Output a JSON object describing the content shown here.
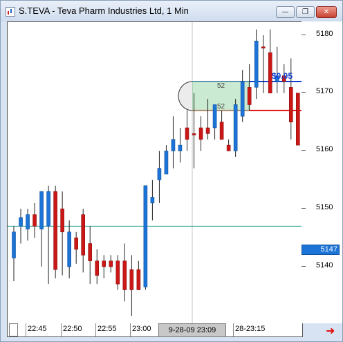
{
  "window": {
    "title": "S.TEVA - Teva Pharm Industries Ltd, 1 Min",
    "buttons": {
      "minimize": "—",
      "maximize": "❐",
      "close": "✕"
    }
  },
  "chart_data": {
    "type": "candlestick",
    "symbol": "S.TEVA",
    "interval": "1 Min",
    "y_ticks": [
      5180,
      5170,
      5160,
      5150,
      5140
    ],
    "ylim": [
      5130,
      5184
    ],
    "x_ticks": [
      "22:45",
      "22:50",
      "22:55",
      "23:00",
      "9-28-09  23:09",
      "28-23:15"
    ],
    "current_price_label": "5147",
    "horizontal_lines": [
      {
        "label": "current",
        "value": 5147,
        "color": "#169a86"
      },
      {
        "label": "red-level",
        "value": 5167,
        "color": "#e01010"
      },
      {
        "label": "blue-level",
        "value": 5172,
        "color": "#1040d0"
      }
    ],
    "annotations": {
      "blue_level_text": "$0.05",
      "box_top_label": "52",
      "box_bottom_label": "52"
    },
    "candles": [
      {
        "o": 5141.5,
        "h": 5147,
        "l": 5137.5,
        "c": 5146,
        "dir": "up"
      },
      {
        "o": 5147,
        "h": 5150,
        "l": 5144,
        "c": 5148.5,
        "dir": "up"
      },
      {
        "o": 5146.5,
        "h": 5150,
        "l": 5144.5,
        "c": 5149,
        "dir": "up"
      },
      {
        "o": 5149,
        "h": 5151,
        "l": 5145,
        "c": 5147,
        "dir": "down"
      },
      {
        "o": 5146.5,
        "h": 5152.5,
        "l": 5140,
        "c": 5153,
        "dir": "up"
      },
      {
        "o": 5147,
        "h": 5154,
        "l": 5137,
        "c": 5153,
        "dir": "up"
      },
      {
        "o": 5153,
        "h": 5154,
        "l": 5138,
        "c": 5139.5,
        "dir": "down"
      },
      {
        "o": 5146,
        "h": 5153,
        "l": 5138.5,
        "c": 5150,
        "dir": "down"
      },
      {
        "o": 5140,
        "h": 5148,
        "l": 5138,
        "c": 5146,
        "dir": "up"
      },
      {
        "o": 5145,
        "h": 5146,
        "l": 5140.5,
        "c": 5143,
        "dir": "down"
      },
      {
        "o": 5149,
        "h": 5150,
        "l": 5139,
        "c": 5142,
        "dir": "down"
      },
      {
        "o": 5144,
        "h": 5147,
        "l": 5137,
        "c": 5141,
        "dir": "down"
      },
      {
        "o": 5141,
        "h": 5143,
        "l": 5137,
        "c": 5138.5,
        "dir": "down"
      },
      {
        "o": 5140,
        "h": 5142,
        "l": 5138,
        "c": 5141,
        "dir": "down"
      },
      {
        "o": 5140,
        "h": 5142,
        "l": 5139,
        "c": 5141,
        "dir": "down"
      },
      {
        "o": 5141,
        "h": 5142,
        "l": 5136,
        "c": 5137,
        "dir": "down"
      },
      {
        "o": 5141,
        "h": 5144,
        "l": 5134,
        "c": 5136,
        "dir": "down"
      },
      {
        "o": 5139.5,
        "h": 5142,
        "l": 5131.5,
        "c": 5136,
        "dir": "down"
      },
      {
        "o": 5139.5,
        "h": 5141,
        "l": 5136,
        "c": 5136,
        "dir": "down"
      },
      {
        "o": 5136.5,
        "h": 5154,
        "l": 5136,
        "c": 5154,
        "dir": "up"
      },
      {
        "o": 5152,
        "h": 5155,
        "l": 5148,
        "c": 5151,
        "dir": "up"
      },
      {
        "o": 5155,
        "h": 5160,
        "l": 5151,
        "c": 5157,
        "dir": "up"
      },
      {
        "o": 5156,
        "h": 5161,
        "l": 5156,
        "c": 5160,
        "dir": "up"
      },
      {
        "o": 5160,
        "h": 5166,
        "l": 5157,
        "c": 5162,
        "dir": "up"
      },
      {
        "o": 5160,
        "h": 5164,
        "l": 5158,
        "c": 5161,
        "dir": "up"
      },
      {
        "o": 5164,
        "h": 5167,
        "l": 5160,
        "c": 5162,
        "dir": "down"
      },
      {
        "o": 5163,
        "h": 5170,
        "l": 5157,
        "c": 5163,
        "dir": "down"
      },
      {
        "o": 5162,
        "h": 5166,
        "l": 5160,
        "c": 5164,
        "dir": "down"
      },
      {
        "o": 5163,
        "h": 5169,
        "l": 5162,
        "c": 5164,
        "dir": "down"
      },
      {
        "o": 5164,
        "h": 5168,
        "l": 5162,
        "c": 5168,
        "dir": "up"
      },
      {
        "o": 5165,
        "h": 5167,
        "l": 5162,
        "c": 5162,
        "dir": "down"
      },
      {
        "o": 5161,
        "h": 5162,
        "l": 5160,
        "c": 5160,
        "dir": "down"
      },
      {
        "o": 5160,
        "h": 5169,
        "l": 5159,
        "c": 5168,
        "dir": "up"
      },
      {
        "o": 5166,
        "h": 5174,
        "l": 5165,
        "c": 5172,
        "dir": "up"
      },
      {
        "o": 5171,
        "h": 5175,
        "l": 5167,
        "c": 5168,
        "dir": "down"
      },
      {
        "o": 5171,
        "h": 5181,
        "l": 5169,
        "c": 5179,
        "dir": "up"
      },
      {
        "o": 5178,
        "h": 5180,
        "l": 5170,
        "c": 5178,
        "dir": "down"
      },
      {
        "o": 5177,
        "h": 5181,
        "l": 5172,
        "c": 5170,
        "dir": "down"
      },
      {
        "o": 5172,
        "h": 5178,
        "l": 5170,
        "c": 5173,
        "dir": "up"
      },
      {
        "o": 5173,
        "h": 5175,
        "l": 5170,
        "c": 5172,
        "dir": "down"
      },
      {
        "o": 5171,
        "h": 5176,
        "l": 5162,
        "c": 5165,
        "dir": "down"
      },
      {
        "o": 5170,
        "h": 5168,
        "l": 5161,
        "c": 5161,
        "dir": "down"
      },
      {
        "o": 5161,
        "h": 5170,
        "l": 5161,
        "c": 5169,
        "dir": "up"
      }
    ]
  }
}
